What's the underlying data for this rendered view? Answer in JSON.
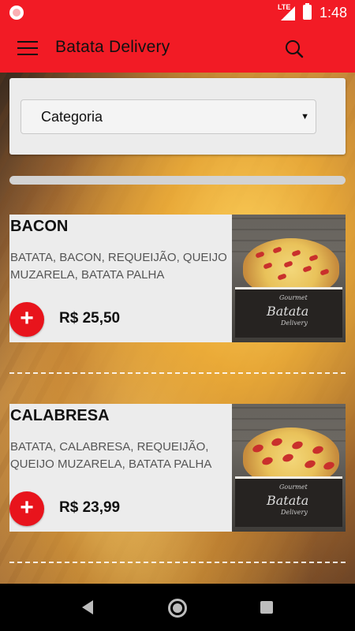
{
  "status_bar": {
    "network": "LTE",
    "time": "1:48"
  },
  "app_bar": {
    "title": "Batata Delivery"
  },
  "filter": {
    "category_label": "Categoria"
  },
  "products": [
    {
      "name": "BACON",
      "description": "BATATA, BACON, REQUEIJÃO, QUEIJO MUZARELA, BATATA PALHA",
      "price": "R$ 25,50",
      "add_label": "+",
      "image_brand": "Batata",
      "image_top": "Gourmet",
      "image_bottom": "Delivery"
    },
    {
      "name": "CALABRESA",
      "description": "BATATA, CALABRESA, REQUEIJÃO, QUEIJO MUZARELA, BATATA PALHA",
      "price": "R$ 23,99",
      "add_label": "+",
      "image_brand": "Batata",
      "image_top": "Gourmet",
      "image_bottom": "Delivery"
    }
  ],
  "colors": {
    "primary": "#f21b25",
    "add_button": "#e8141c"
  }
}
